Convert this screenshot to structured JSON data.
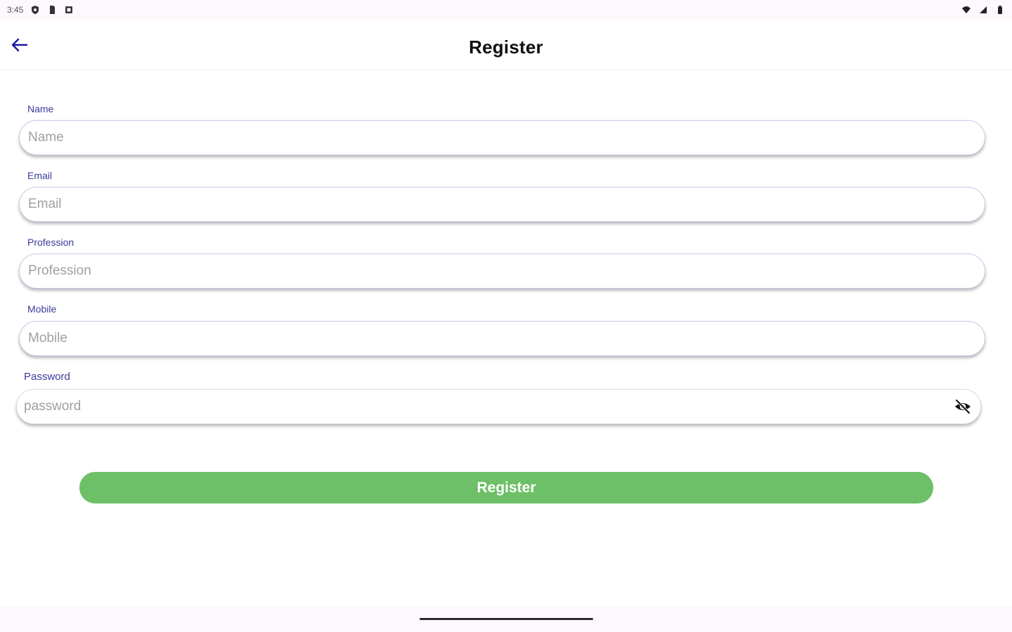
{
  "status_bar": {
    "time": "3:45",
    "left_icons": [
      "shield-icon",
      "sim-card-icon",
      "screenshot-icon"
    ],
    "right_icons": [
      "wifi-icon",
      "signal-icon",
      "battery-icon"
    ]
  },
  "app_bar": {
    "title": "Register",
    "back_icon": "arrow-left-icon",
    "accent_color": "#1a1aa0"
  },
  "form": {
    "label_color": "#3b3b9a",
    "fields": [
      {
        "label": "Name",
        "placeholder": "Name",
        "value": ""
      },
      {
        "label": "Email",
        "placeholder": "Email",
        "value": ""
      },
      {
        "label": "Profession",
        "placeholder": "Profession",
        "value": ""
      },
      {
        "label": "Mobile",
        "placeholder": "Mobile",
        "value": ""
      }
    ],
    "password": {
      "label": "Password",
      "placeholder": "password",
      "value": "",
      "toggle_icon": "eye-off-icon"
    }
  },
  "register_button": {
    "label": "Register",
    "color": "#6dc067"
  }
}
